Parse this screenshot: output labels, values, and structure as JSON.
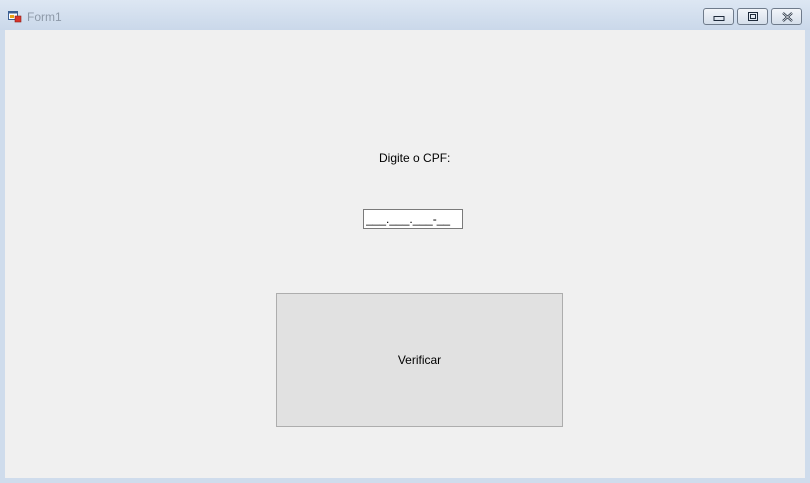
{
  "window": {
    "title": "Form1",
    "icon": "winforms-app-icon",
    "controls": {
      "minimize_icon": "minimize-icon",
      "maximize_icon": "maximize-icon",
      "close_icon": "close-icon"
    }
  },
  "form": {
    "cpf_label": "Digite o CPF:",
    "cpf_input_value": "___.___.___-__",
    "verify_button_label": "Verificar"
  },
  "colors": {
    "form_background": "#f0f0f0",
    "button_background": "#e1e1e1",
    "title_text": "#8d99a8"
  }
}
